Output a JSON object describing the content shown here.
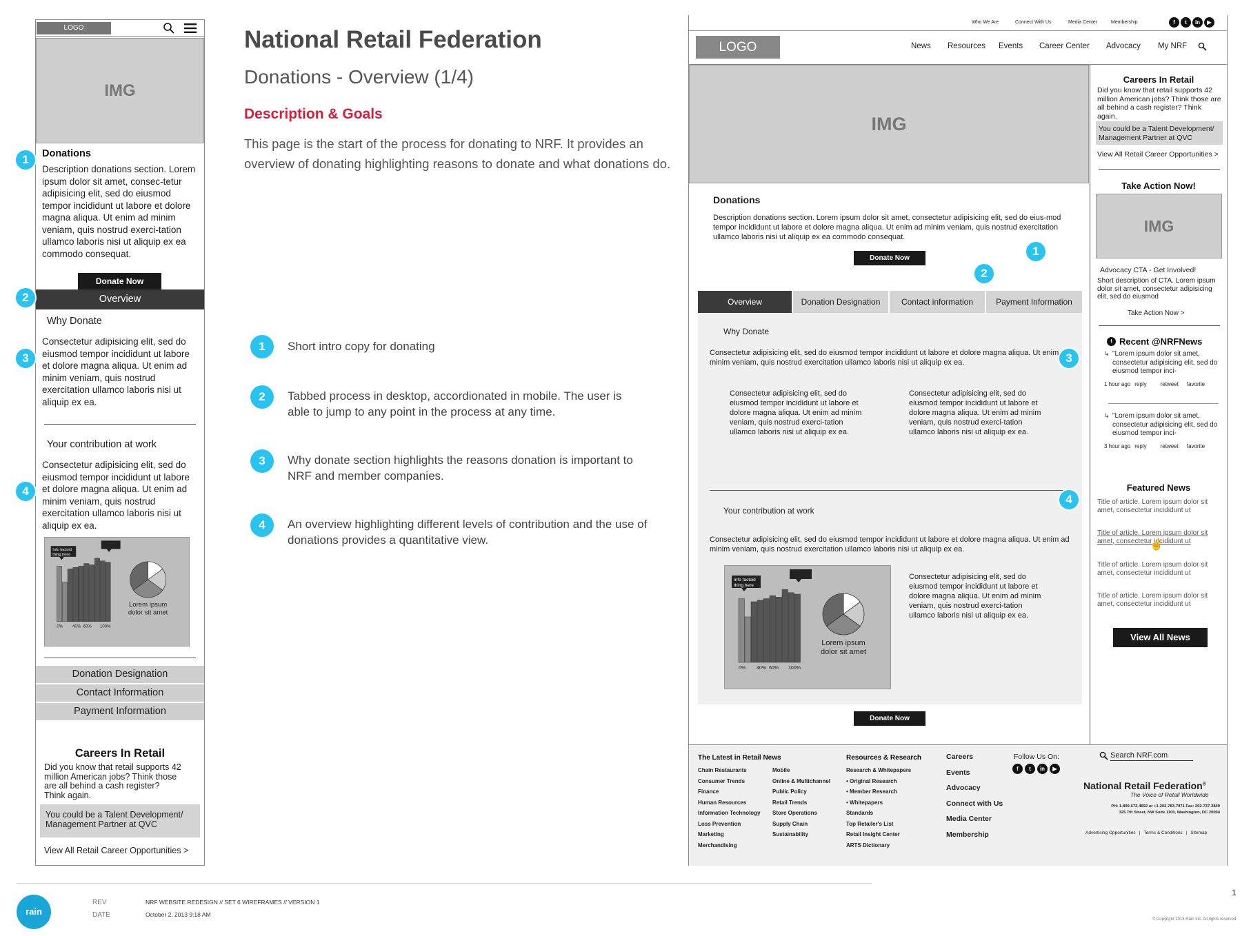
{
  "page": {
    "title": "National Retail Federation",
    "subtitle": "Donations - Overview (1/4)",
    "section_heading": "Description & Goals",
    "description": "This page is the start of the process for donating to NRF. It provides an overview of donating highlighting reasons to donate and what donations do.",
    "page_number": "1",
    "copyright": "© Copyright 2013 Rain Inc. All rights reserved."
  },
  "legend": [
    {
      "num": "1",
      "text": "Short intro copy for donating"
    },
    {
      "num": "2",
      "text": "Tabbed process in desktop, accordionated in mobile. The user is able to jump to any point in the process at any time."
    },
    {
      "num": "3",
      "text": "Why donate section highlights the reasons donation is important to NRF and member companies."
    },
    {
      "num": "4",
      "text": "An overview highlighting different levels of contribution and the use of donations provides a quantitative view."
    }
  ],
  "footer_meta": {
    "logo": "rain",
    "rev_label": "REV",
    "date_label": "DATE",
    "rev_value": "NRF WEBSITE REDESIGN // SET 6 WIREFRAMES // VERSION 1",
    "date_value": "October 2, 2013 9:18 AM"
  },
  "common": {
    "logo": "LOGO",
    "img": "IMG",
    "donations_title": "Donations",
    "donate_now": "Donate Now",
    "why_donate": "Why Donate",
    "your_contribution": "Your contribution at work",
    "body_short": "Consectetur adipisicing elit, sed do eiusmod tempor incididunt ut labore et dolore magna aliqua. Ut enim ad minim veniam, quis nostrud exercitation ullamco laboris nisi ut aliquip ex ea.",
    "body_col": "Consectetur adipisicing elit, sed do eiusmod tempor incididunt ut labore et dolore magna aliqua. Ut enim ad minim veniam, quis nostrud exerci-tation ullamco laboris nisi ut aliquip ex ea.",
    "info_factoid": "Info factoid thing here",
    "chart_caption": "Lorem ipsum dolor sit amet"
  },
  "chart_data": {
    "type": "bar",
    "categories": [
      "0%",
      "40%",
      "60%",
      "100%"
    ],
    "bar_values": [
      84,
      60,
      80,
      82,
      84,
      88,
      86,
      96,
      92,
      90
    ],
    "pie_values": [
      15,
      20,
      30,
      35
    ],
    "xlabel": "",
    "ylabel": ""
  },
  "mobile": {
    "donations_desc": "Description donations section. Lorem ipsum dolor sit amet, consec-tetur adipisicing elit, sed do eiusmod tempor incididunt ut labore et dolore magna aliqua. Ut enim ad minim veniam, quis nostrud exerci-tation ullamco laboris nisi ut aliquip ex ea commodo consequat.",
    "accordion": [
      "Overview",
      "Donation Designation",
      "Contact Information",
      "Payment Information"
    ],
    "careers_title": "Careers In Retail",
    "careers_text": "Did you know that retail supports 42 million American jobs? Think those are all behind a cash register? Think again.",
    "careers_box": "You could be a Talent Development/ Management Partner at QVC",
    "careers_link": "View All Retail Career Opportunities >"
  },
  "desktop": {
    "utility_nav": [
      "Who We Are",
      "Connect With Us",
      "Media Center",
      "Membership"
    ],
    "main_nav": [
      "News",
      "Resources",
      "Events",
      "Career Center",
      "Advocacy",
      "My NRF"
    ],
    "donations_desc": "Description donations section. Lorem ipsum dolor sit amet, consectetur adipisicing elit, sed do eius-mod tempor incididunt ut labore et dolore magna aliqua. Ut enim ad minim veniam, quis nostrud exercitation ullamco laboris nisi ut aliquip ex ea commodo consequat.",
    "tabs": [
      "Overview",
      "Donation Designation",
      "Contact information",
      "Payment Information"
    ],
    "sidebar": {
      "careers_title": "Careers In Retail",
      "careers_text": "Did you know that retail supports 42 million American jobs? Think those are all behind a cash register? Think again.",
      "careers_box": "You could be a Talent Development/ Management Partner at QVC",
      "careers_link": "View All Retail Career Opportunities >",
      "action_title": "Take Action Now!",
      "action_cta": "Advocacy CTA - Get Involved!",
      "action_desc": "Short description of CTA. Lorem ipsum dolor sit amet, consectetur adipisicing elit, sed do eiusmod",
      "action_link": "Take Action Now >",
      "recent_title": "Recent @NRFNews",
      "tweets": [
        {
          "text": "\"Lorem ipsum dolor sit amet, consectetur adipisicing elit, sed do eiusmod tempor inci-",
          "time": "1 hour ago",
          "reply": "reply",
          "retweet": "retweet",
          "favorite": "favorite"
        },
        {
          "text": "\"Lorem ipsum dolor sit amet, consectetur adipisicing elit, sed do eiusmod tempor inci-",
          "time": "3 hour ago",
          "reply": "reply",
          "retweet": "retweet",
          "favorite": "favorite"
        }
      ],
      "featured_title": "Featured News",
      "news": [
        "Title of article. Lorem ipsum dolor sit amet, consectetur incididunt ut",
        "Title of article. Lorem ipsum dolor sit amet, consectetur incididunt ut",
        "Title of article. Lorem ipsum dolor sit amet, consectetur incididunt ut",
        "Title of article. Lorem ipsum dolor sit amet, consectetur incididunt ut"
      ],
      "view_all_news": "View All News"
    },
    "footer": {
      "latest_title": "The Latest in Retail News",
      "latest_col1": [
        "Chain Restaurants",
        "Consumer Trends",
        "Finance",
        "Human Resources",
        "Information Technology",
        "Loss Prevention",
        "Marketing",
        "Merchandising"
      ],
      "latest_col2": [
        "Mobile",
        "Online & Multichannel",
        "Public Policy",
        "Retail Trends",
        "Store Operations",
        "Supply Chain",
        "Sustainability"
      ],
      "resources_title": "Resources & Research",
      "resources": [
        "Research & Whitepapers",
        "• Original Research",
        "• Member Research",
        "• Whitepapers",
        "Standards",
        "Top Retailer's List",
        "Retail Insight Center",
        "ARTS Dictionary"
      ],
      "main_links": [
        "Careers",
        "Events",
        "Advocacy",
        "Connect with Us",
        "Media Center",
        "Membership"
      ],
      "follow": "Follow Us On:",
      "search_placeholder": "Search NRF.com",
      "nrf_name": "National Retail Federation",
      "tagline": "The Voice of Retail Worldwide",
      "contact1": "PH: 1-800-673-4692 or +1-202-783-7971  Fax: 202-737-2849",
      "contact2": "325 7th Street, NW Suite 1100, Washington, DC 20004",
      "legal": [
        "Advertising Opportunities",
        "Terms & Conditions",
        "Sitemap"
      ]
    }
  }
}
